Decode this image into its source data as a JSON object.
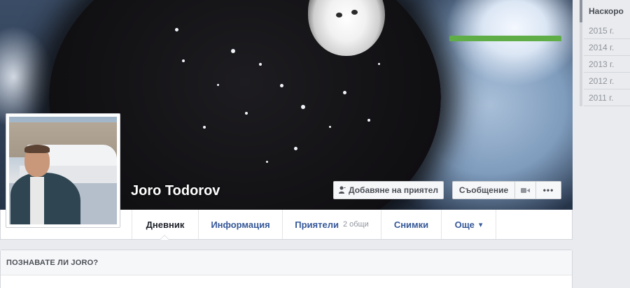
{
  "profile": {
    "name": "Joro Todorov"
  },
  "cover_actions": {
    "add_friend": "Добавяне на приятел",
    "message": "Съобщение",
    "more": "•••"
  },
  "tabs": [
    {
      "label": "Дневник",
      "active": true
    },
    {
      "label": "Информация",
      "active": false
    },
    {
      "label": "Приятели",
      "count": "2 общи",
      "active": false
    },
    {
      "label": "Снимки",
      "active": false
    },
    {
      "label": "Още",
      "suffix": "▾",
      "active": false
    }
  ],
  "know_box": {
    "title": "ПОЗНАВАТЕ ЛИ JORO?"
  },
  "year_nav": [
    "Наскоро",
    "2015 г.",
    "2014 г.",
    "2013 г.",
    "2012 г.",
    "2011 г."
  ],
  "colors": {
    "link_blue": "#365899",
    "page_bg": "#e9ebee",
    "confirm_green": "#5fad46"
  },
  "icons": {
    "add_friend": "person-plus-icon",
    "video": "video-camera-icon",
    "more": "more-dots-icon",
    "dropdown": "caret-down-icon"
  }
}
